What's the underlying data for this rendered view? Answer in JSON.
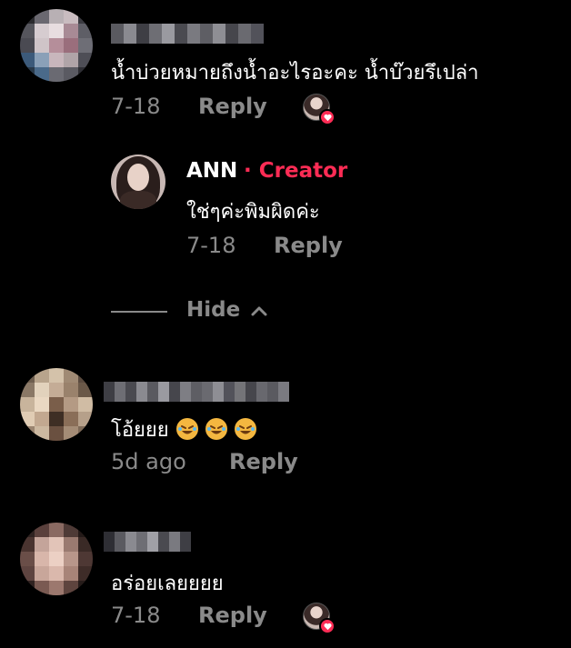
{
  "comments": [
    {
      "text": "น้ำบ่วยหมายถึงน้ำอะไรอะคะ น้ำบ๊วยรึเปล่า",
      "date": "7-18",
      "reply_label": "Reply",
      "replies": [
        {
          "author": "ANN",
          "creator_tag": "· Creator",
          "text": "ใช่ๆค่ะพิมผิดค่ะ",
          "date": "7-18",
          "reply_label": "Reply"
        }
      ]
    },
    {
      "text": "โอ้ยยย",
      "emojis": [
        "rolling-on-floor-laughing",
        "rolling-on-floor-laughing",
        "rolling-on-floor-laughing"
      ],
      "date": "5d ago",
      "reply_label": "Reply"
    },
    {
      "text": "อร่อยเลยยยย",
      "date": "7-18",
      "reply_label": "Reply"
    }
  ],
  "hide_label": "Hide",
  "colors": {
    "background": "#000000",
    "meta_gray": "#8a8a8a",
    "creator_red": "#fe2c55",
    "emoji_yellow": "#f4b740"
  },
  "icons": {
    "hide_chevron": "chevron-up-icon",
    "liked_badge": "heart-icon"
  }
}
